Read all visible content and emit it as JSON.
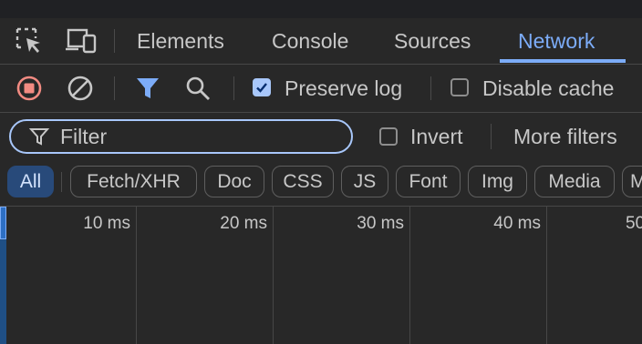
{
  "tabs": [
    {
      "label": "Elements",
      "active": false
    },
    {
      "label": "Console",
      "active": false
    },
    {
      "label": "Sources",
      "active": false
    },
    {
      "label": "Network",
      "active": true
    }
  ],
  "toolbar": {
    "preserve_log": {
      "label": "Preserve log",
      "checked": true
    },
    "disable_cache": {
      "label": "Disable cache",
      "checked": false
    }
  },
  "filter": {
    "placeholder": "Filter",
    "invert": {
      "label": "Invert",
      "checked": false
    },
    "more_filters": "More filters"
  },
  "type_filters": [
    "All",
    "Fetch/XHR",
    "Doc",
    "CSS",
    "JS",
    "Font",
    "Img",
    "Media",
    "M"
  ],
  "active_type_filter": "All",
  "timeline": {
    "ticks": [
      "10 ms",
      "20 ms",
      "30 ms",
      "40 ms",
      "50"
    ]
  },
  "colors": {
    "accent": "#7cacf8",
    "record_red": "#f28b82",
    "background": "#282828"
  }
}
